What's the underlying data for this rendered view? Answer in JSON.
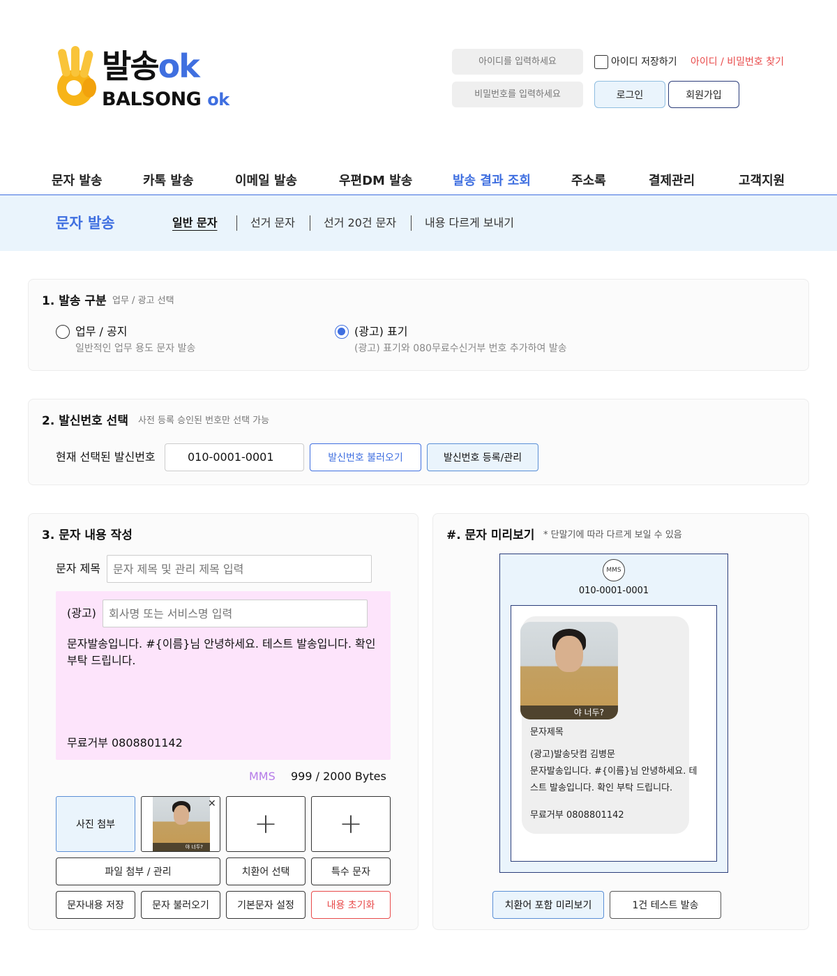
{
  "brand": {
    "name_ko": "발송",
    "ok": "ok",
    "name_en": "BALSONG",
    "ok_small": "ok"
  },
  "login": {
    "id_placeholder": "아이디를 입력하세요",
    "pw_placeholder": "비밀번호를 입력하세요",
    "save_id_label": "아이디 저장하기",
    "find_link": "아이디 / 비밀번호 찾기",
    "login_button": "로그인",
    "join_button": "회원가입"
  },
  "gnb": {
    "items": [
      {
        "label": "문자 발송"
      },
      {
        "label": "카톡 발송"
      },
      {
        "label": "이메일 발송"
      },
      {
        "label": "우편DM 발송"
      },
      {
        "label": "발송 결과 조회"
      },
      {
        "label": "주소록"
      },
      {
        "label": "결제관리"
      },
      {
        "label": "고객지원"
      }
    ],
    "active_index": 4
  },
  "subnav": {
    "title": "문자 발송",
    "tabs": [
      {
        "label": "일반 문자"
      },
      {
        "label": "선거 문자"
      },
      {
        "label": "선거 20건 문자"
      },
      {
        "label": "내용 다르게 보내기"
      }
    ],
    "active_index": 0
  },
  "section1": {
    "title": "1. 발송 구분",
    "desc": "업무 / 광고 선택",
    "options": [
      {
        "label": "업무 / 공지",
        "desc": "일반적인 업무 용도 문자 발송",
        "selected": false
      },
      {
        "label": "(광고) 표기",
        "desc": "(광고) 표기와 080무료수신거부 번호 추가하여 발송",
        "selected": true
      }
    ]
  },
  "section2": {
    "title": "2. 발신번호 선택",
    "desc": "사전 등록 승인된 번호만 선택 가능",
    "current_label": "현재 선택된 발신번호",
    "current_number": "010-0001-0001",
    "load_button": "발신번호 불러오기",
    "manage_button": "발신번호 등록/관리"
  },
  "section3": {
    "title": "3. 문자 내용 작성",
    "subject_label": "문자 제목",
    "subject_placeholder": "문자 제목 및 관리 제목 입력",
    "ad_prefix": "(광고)",
    "company_placeholder": "회사명 또는 서비스명 입력",
    "body_line1": "문자발송입니다. #{이름}님 안녕하세요. 테스트 발송입니다. 확인",
    "body_line2": "부탁 드립니다.",
    "optout": "무료거부 0808801142",
    "msg_type": "MMS",
    "bytes": "999 / 2000 Bytes",
    "photo_attach": "사진 첨부",
    "photo_caption": "야 너두?",
    "remove_symbol": "✕",
    "plus_symbol": "+",
    "buttons": {
      "file_manage": "파일 첨부 / 관리",
      "replace_word": "치환어 선택",
      "special_char": "특수 문자",
      "save_content": "문자내용 저장",
      "load_message": "문자 불러오기",
      "default_setting": "기본문자 설정",
      "reset": "내용 초기화"
    }
  },
  "preview": {
    "title": "#. 문자 미리보기",
    "note": "* 단말기에 따라 다르게 보일 수 있음",
    "badge": "MMS",
    "number": "010-0001-0001",
    "photo_caption": "야 너두?",
    "msg_title": "문자제목",
    "line1": "(광고)발송닷컴 김병문",
    "line2": "문자발송입니다. #{이름}님 안녕하세요. 테",
    "line3": "스트 발송입니다. 확인 부탁 드립니다.",
    "optout": "무료거부 0808801142",
    "preview_button": "치환어 포함 미리보기",
    "test_button": "1건 테스트 발송"
  },
  "colors": {
    "accent": "#3f6fe0",
    "warning": "#e84a4a",
    "message_bg": "#fde4fb",
    "light_blue": "#eaf4fc",
    "mms": "#b57be8"
  }
}
